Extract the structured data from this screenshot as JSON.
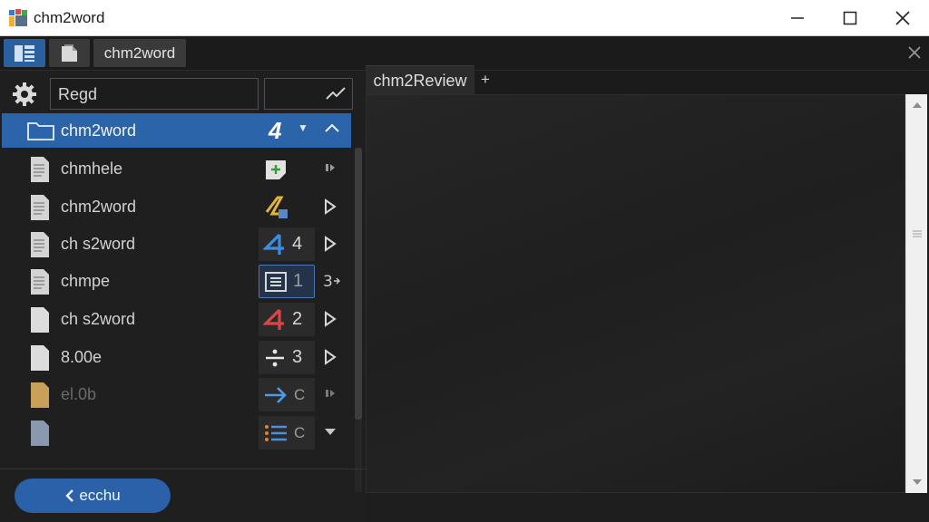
{
  "window": {
    "title": "chm2word",
    "controls": {
      "minimize": "minimize",
      "maximize": "maximize",
      "close": "close"
    }
  },
  "toolbar": {
    "view_button_icon": "panel-view-icon",
    "doc_button_icon": "document-stack-icon",
    "tab_label": "chm2word"
  },
  "sidebar": {
    "search_value": "Regd",
    "selected": {
      "label": "chm2word",
      "number": "4"
    },
    "items": [
      {
        "label": "chmhele",
        "action_text": "",
        "action_icon": "add-file-icon",
        "arrow": "small-square-icon",
        "dim": false
      },
      {
        "label": "chm2word",
        "action_text": "",
        "action_icon": "yellow-edit-icon",
        "arrow": "play-arrow-icon",
        "dim": false
      },
      {
        "label": "ch s2word",
        "action_text": "4",
        "action_icon": "blue-four-icon",
        "arrow": "play-arrow-icon",
        "dim": false
      },
      {
        "label": "chmpe",
        "action_text": "1",
        "action_icon": "framed-list-icon",
        "arrow": "three-arrow-icon",
        "dim": false
      },
      {
        "label": "ch s2word",
        "action_text": "2",
        "action_icon": "red-four-icon",
        "arrow": "play-arrow-icon",
        "dim": false
      },
      {
        "label": "8.00e",
        "action_text": "3",
        "action_icon": "divide-icon",
        "arrow": "play-arrow-icon",
        "dim": false
      },
      {
        "label": "el.0b",
        "action_text": "C",
        "action_icon": "right-arrow-icon",
        "arrow": "small-square-icon",
        "dim": true
      },
      {
        "label": "",
        "action_text": "C",
        "action_icon": "list-lines-icon",
        "arrow": "dropdown-arrow-icon",
        "dim": false
      }
    ],
    "back_button": "ecchu"
  },
  "preview": {
    "tab_label": "chm2Review",
    "add_tab": "+"
  }
}
